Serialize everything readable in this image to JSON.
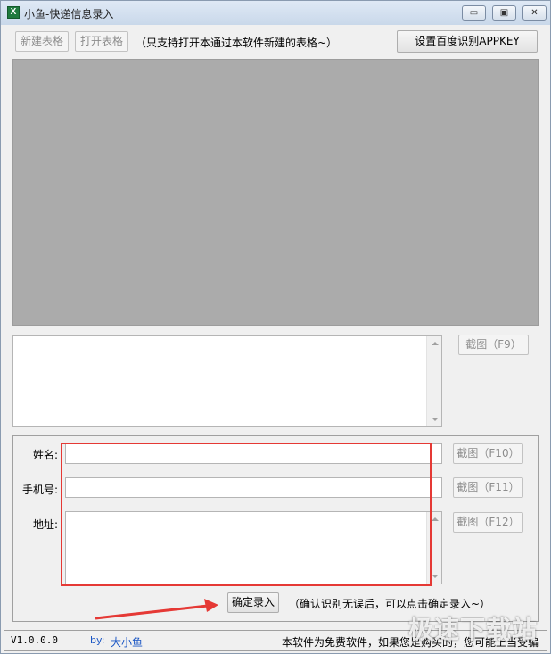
{
  "window": {
    "title": "小鱼-快递信息录入",
    "app_icon": "X",
    "minimize_glyph": "▭",
    "maximize_glyph": "▣",
    "close_glyph": "✕"
  },
  "toolbar": {
    "new_table_label": "新建表格",
    "open_table_label": "打开表格",
    "hint": "（只支持打开本通过本软件新建的表格~）",
    "appkey_label": "设置百度识别APPKEY"
  },
  "ocr": {
    "screenshot_f9": "截图（F9）"
  },
  "form": {
    "name_label": "姓名:",
    "phone_label": "手机号:",
    "address_label": "地址:",
    "name_value": "",
    "phone_value": "",
    "address_value": "",
    "screenshot_f10": "截图（F10）",
    "screenshot_f11": "截图（F11）",
    "screenshot_f12": "截图（F12）",
    "confirm_label": "确定录入",
    "confirm_hint": "（确认识别无误后，可以点击确定录入~）"
  },
  "status": {
    "version": "V1.0.0.0",
    "by_label": "by:",
    "author": "大小鱼",
    "notice": "本软件为免费软件，如果您是购买的，您可能上当受骗"
  },
  "annotation": {
    "highlight_color": "#e53935"
  },
  "watermark": {
    "text": "极速下载站"
  }
}
